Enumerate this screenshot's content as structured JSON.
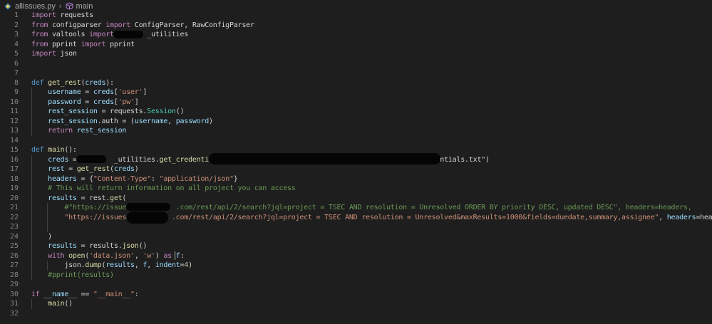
{
  "breadcrumb": {
    "file": "allissues.py",
    "symbol": "main",
    "separator": "›"
  },
  "colors": {
    "background": "#1e1e1e",
    "keyword": "#c586c0",
    "string": "#ce9178",
    "comment": "#6a9955",
    "function": "#dcdcaa",
    "variable": "#9cdcfe"
  },
  "code": {
    "lines": [
      {
        "n": "1",
        "segs": [
          {
            "t": "import",
            "c": "kw"
          },
          {
            "t": " requests"
          }
        ]
      },
      {
        "n": "2",
        "segs": [
          {
            "t": "from",
            "c": "kw"
          },
          {
            "t": " configparser "
          },
          {
            "t": "import",
            "c": "kw"
          },
          {
            "t": " ConfigParser, RawConfigParser"
          }
        ]
      },
      {
        "n": "3",
        "segs": [
          {
            "t": "from",
            "c": "kw"
          },
          {
            "t": " valtools "
          },
          {
            "t": "import",
            "c": "kw"
          },
          {
            "t": "        _utilities"
          }
        ]
      },
      {
        "n": "4",
        "segs": [
          {
            "t": "from",
            "c": "kw"
          },
          {
            "t": " pprint "
          },
          {
            "t": "import",
            "c": "kw"
          },
          {
            "t": " pprint"
          }
        ]
      },
      {
        "n": "5",
        "segs": [
          {
            "t": "import",
            "c": "kw"
          },
          {
            "t": " json"
          }
        ]
      },
      {
        "n": "6",
        "segs": []
      },
      {
        "n": "7",
        "segs": []
      },
      {
        "n": "8",
        "segs": [
          {
            "t": "def",
            "c": "def"
          },
          {
            "t": " "
          },
          {
            "t": "get_rest",
            "c": "fn"
          },
          {
            "t": "("
          },
          {
            "t": "creds",
            "c": "var"
          },
          {
            "t": "):"
          }
        ]
      },
      {
        "n": "9",
        "segs": [
          {
            "t": "    "
          },
          {
            "t": "username",
            "c": "var"
          },
          {
            "t": " = "
          },
          {
            "t": "creds",
            "c": "var"
          },
          {
            "t": "["
          },
          {
            "t": "'user'",
            "c": "str"
          },
          {
            "t": "]"
          }
        ]
      },
      {
        "n": "10",
        "segs": [
          {
            "t": "    "
          },
          {
            "t": "password",
            "c": "var"
          },
          {
            "t": " = "
          },
          {
            "t": "creds",
            "c": "var"
          },
          {
            "t": "["
          },
          {
            "t": "'pw'",
            "c": "str"
          },
          {
            "t": "]"
          }
        ]
      },
      {
        "n": "11",
        "segs": [
          {
            "t": "    "
          },
          {
            "t": "rest_session",
            "c": "var"
          },
          {
            "t": " = requests."
          },
          {
            "t": "Session",
            "c": "cls"
          },
          {
            "t": "()"
          }
        ]
      },
      {
        "n": "12",
        "segs": [
          {
            "t": "    "
          },
          {
            "t": "rest_session",
            "c": "var"
          },
          {
            "t": ".auth = ("
          },
          {
            "t": "username",
            "c": "var"
          },
          {
            "t": ", "
          },
          {
            "t": "password",
            "c": "var"
          },
          {
            "t": ")"
          }
        ]
      },
      {
        "n": "13",
        "segs": [
          {
            "t": "    "
          },
          {
            "t": "return",
            "c": "kw"
          },
          {
            "t": " "
          },
          {
            "t": "rest_session",
            "c": "var"
          }
        ]
      },
      {
        "n": "14",
        "segs": []
      },
      {
        "n": "15",
        "segs": [
          {
            "t": "def",
            "c": "def"
          },
          {
            "t": " "
          },
          {
            "t": "main",
            "c": "fn"
          },
          {
            "t": "():"
          }
        ]
      },
      {
        "n": "16",
        "segs": [
          {
            "t": "    "
          },
          {
            "t": "creds",
            "c": "var"
          },
          {
            "t": " =         _utilities."
          },
          {
            "t": "get_credentials",
            "c": "fn"
          },
          {
            "t": "(r'                                              redentials.txt\""
          },
          {
            "t": ")"
          }
        ]
      },
      {
        "n": "17",
        "segs": [
          {
            "t": "    "
          },
          {
            "t": "rest",
            "c": "var"
          },
          {
            "t": " = "
          },
          {
            "t": "get_rest",
            "c": "fn"
          },
          {
            "t": "("
          },
          {
            "t": "creds",
            "c": "var"
          },
          {
            "t": ")"
          }
        ]
      },
      {
        "n": "18",
        "segs": [
          {
            "t": "    "
          },
          {
            "t": "headers",
            "c": "var"
          },
          {
            "t": " = {"
          },
          {
            "t": "\"Content-Type\"",
            "c": "str"
          },
          {
            "t": ": "
          },
          {
            "t": "\"application/json\"",
            "c": "str"
          },
          {
            "t": "}"
          }
        ]
      },
      {
        "n": "19",
        "segs": [
          {
            "t": "    "
          },
          {
            "t": "# This will return information on all project you can access",
            "c": "cmt"
          }
        ]
      },
      {
        "n": "20",
        "segs": [
          {
            "t": "    "
          },
          {
            "t": "results",
            "c": "var"
          },
          {
            "t": " = rest."
          },
          {
            "t": "get",
            "c": "fn"
          },
          {
            "t": "("
          }
        ]
      },
      {
        "n": "21",
        "segs": [
          {
            "t": "        "
          },
          {
            "t": "#\"https://issues.          .com/rest/api/2/search?jql=project = TSEC AND resolution = Unresolved ORDER BY priority DESC, updated DESC\", headers=headers,",
            "c": "cmt"
          }
        ]
      },
      {
        "n": "22",
        "segs": [
          {
            "t": "        "
          },
          {
            "t": "\"https://issues.          .com/rest/api/2/search?jql=project = TSEC AND resolution = Unresolved&maxResults=1000&fields=duedate,summary,assignee\"",
            "c": "str"
          },
          {
            "t": ", "
          },
          {
            "t": "headers",
            "c": "var"
          },
          {
            "t": "=headers,"
          }
        ]
      },
      {
        "n": "23",
        "segs": []
      },
      {
        "n": "24",
        "segs": [
          {
            "t": "    )"
          }
        ]
      },
      {
        "n": "25",
        "segs": [
          {
            "t": "    "
          },
          {
            "t": "results",
            "c": "var"
          },
          {
            "t": " = results."
          },
          {
            "t": "json",
            "c": "fn"
          },
          {
            "t": "()"
          }
        ]
      },
      {
        "n": "26",
        "segs": [
          {
            "t": "    "
          },
          {
            "t": "with",
            "c": "kw"
          },
          {
            "t": " "
          },
          {
            "t": "open",
            "c": "fn"
          },
          {
            "t": "("
          },
          {
            "t": "'data.json'",
            "c": "str"
          },
          {
            "t": ", "
          },
          {
            "t": "'w'",
            "c": "str"
          },
          {
            "t": ") "
          },
          {
            "t": "as",
            "c": "kw"
          },
          {
            "t": " "
          },
          {
            "t": "f",
            "c": "var"
          },
          {
            "t": ":"
          }
        ]
      },
      {
        "n": "27",
        "segs": [
          {
            "t": "        json."
          },
          {
            "t": "dump",
            "c": "fn"
          },
          {
            "t": "("
          },
          {
            "t": "results",
            "c": "var"
          },
          {
            "t": ", "
          },
          {
            "t": "f",
            "c": "var"
          },
          {
            "t": ", "
          },
          {
            "t": "indent",
            "c": "var"
          },
          {
            "t": "="
          },
          {
            "t": "4",
            "c": "num"
          },
          {
            "t": ")"
          }
        ]
      },
      {
        "n": "28",
        "segs": [
          {
            "t": "    "
          },
          {
            "t": "#pprint(results)",
            "c": "cmt"
          }
        ]
      },
      {
        "n": "29",
        "segs": []
      },
      {
        "n": "30",
        "segs": [
          {
            "t": "if",
            "c": "kw"
          },
          {
            "t": " "
          },
          {
            "t": "__name__",
            "c": "var"
          },
          {
            "t": " == "
          },
          {
            "t": "\"__main__\"",
            "c": "str"
          },
          {
            "t": ":"
          }
        ]
      },
      {
        "n": "31",
        "segs": [
          {
            "t": "    "
          },
          {
            "t": "main",
            "c": "fn"
          },
          {
            "t": "()"
          }
        ]
      },
      {
        "n": "32",
        "segs": []
      }
    ]
  }
}
